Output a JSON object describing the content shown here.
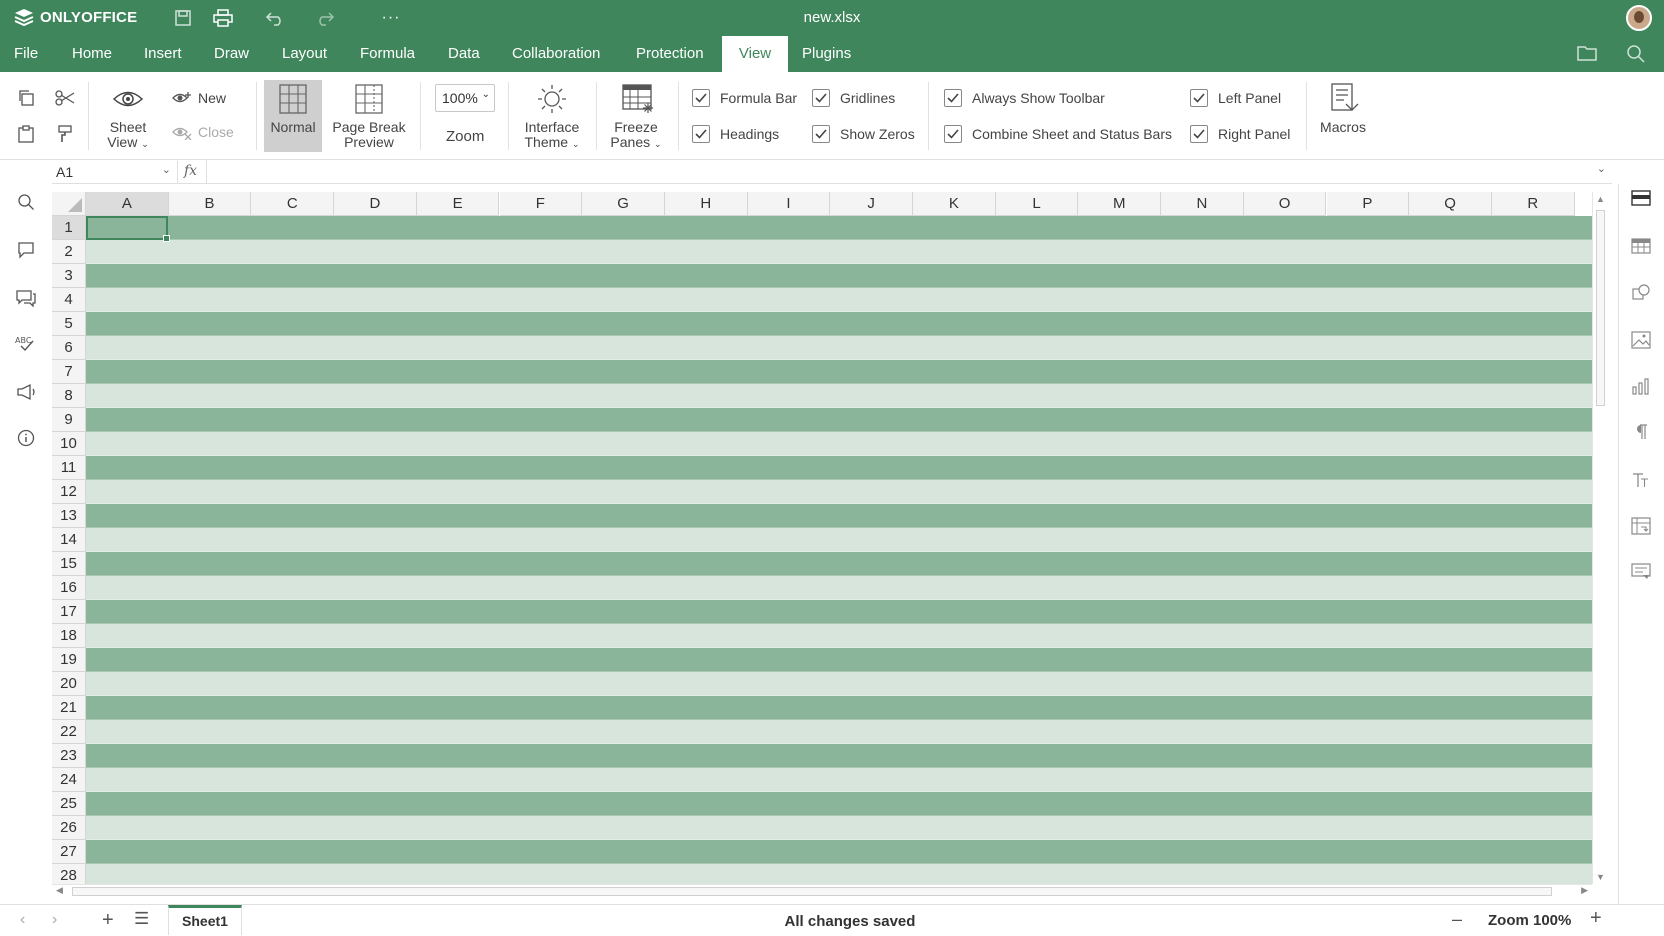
{
  "app": {
    "logo_text": "ONLYOFFICE",
    "doc_title": "new.xlsx",
    "accent": "#40865c"
  },
  "quick_access": {
    "icons": [
      "save-icon",
      "print-icon",
      "undo-icon",
      "redo-icon",
      "more-icon"
    ],
    "more_label": "···"
  },
  "menu_tabs": [
    {
      "label": "File"
    },
    {
      "label": "Home"
    },
    {
      "label": "Insert"
    },
    {
      "label": "Draw"
    },
    {
      "label": "Layout"
    },
    {
      "label": "Formula"
    },
    {
      "label": "Data"
    },
    {
      "label": "Collaboration"
    },
    {
      "label": "Protection"
    },
    {
      "label": "View",
      "active": true
    },
    {
      "label": "Plugins"
    }
  ],
  "ribbon": {
    "sheet_view": "Sheet View",
    "sheet_view_lines": [
      "Sheet",
      "View"
    ],
    "new_label": "New",
    "close_label": "Close",
    "normal_label": "Normal",
    "page_break_lines": [
      "Page Break",
      "Preview"
    ],
    "zoom_value": "100%",
    "zoom_label": "Zoom",
    "interface_theme_lines": [
      "Interface",
      "Theme"
    ],
    "freeze_panes_lines": [
      "Freeze",
      "Panes"
    ],
    "macros_label": "Macros",
    "checkboxes": {
      "formula_bar": {
        "label": "Formula Bar",
        "checked": true
      },
      "headings": {
        "label": "Headings",
        "checked": true
      },
      "gridlines": {
        "label": "Gridlines",
        "checked": true
      },
      "show_zeros": {
        "label": "Show Zeros",
        "checked": true
      },
      "always_show_toolbar": {
        "label": "Always Show Toolbar",
        "checked": true
      },
      "combine_bars": {
        "label": "Combine Sheet and Status Bars",
        "checked": true
      },
      "left_panel": {
        "label": "Left Panel",
        "checked": true
      },
      "right_panel": {
        "label": "Right Panel",
        "checked": true
      }
    }
  },
  "formula_bar": {
    "name_box": "A1",
    "fx_label": "fx",
    "formula": ""
  },
  "grid": {
    "columns": [
      "A",
      "B",
      "C",
      "D",
      "E",
      "F",
      "G",
      "H",
      "I",
      "J",
      "K",
      "L",
      "M",
      "N",
      "O",
      "P",
      "Q",
      "R"
    ],
    "rows": [
      "1",
      "2",
      "3",
      "4",
      "5",
      "6",
      "7",
      "8",
      "9",
      "10",
      "11",
      "12",
      "13",
      "14",
      "15",
      "16",
      "17",
      "18",
      "19",
      "20",
      "21",
      "22",
      "23",
      "24",
      "25",
      "26",
      "27",
      "28"
    ],
    "selected_cell": "A1",
    "band_dark": "#8bb59b",
    "band_light": "#d8e5dd"
  },
  "statusbar": {
    "sheet_name": "Sheet1",
    "status": "All changes saved",
    "zoom": "Zoom 100%"
  }
}
